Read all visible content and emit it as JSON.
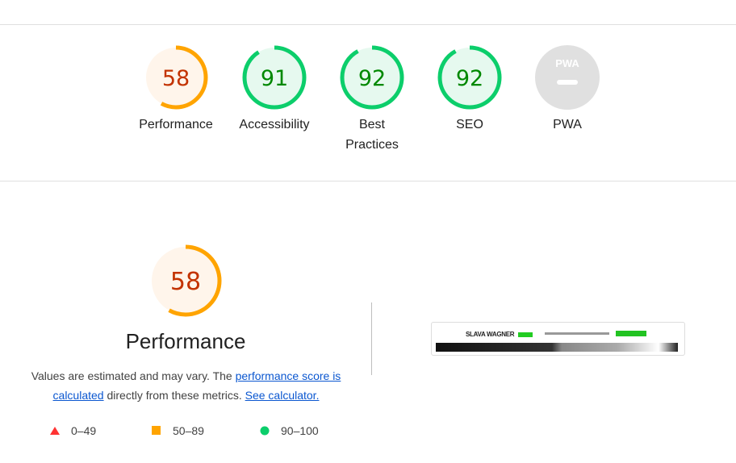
{
  "categories": [
    {
      "label": "Performance",
      "score": 58,
      "rating": "average"
    },
    {
      "label": "Accessibility",
      "score": 91,
      "rating": "pass"
    },
    {
      "label": "Best Practices",
      "score": 92,
      "rating": "pass"
    },
    {
      "label": "SEO",
      "score": 92,
      "rating": "pass"
    },
    {
      "label": "PWA",
      "score": null,
      "rating": "na",
      "badge": "PWA"
    }
  ],
  "colors": {
    "average": "#ffa400",
    "average_text": "#c33300",
    "average_bg": "#fff5eb",
    "pass": "#0cce6b",
    "pass_text": "#008800",
    "pass_bg": "#e6f9ef",
    "fail": "#ff3333",
    "na": "#e0e0e0"
  },
  "performance": {
    "score": "58",
    "title": "Performance",
    "desc_1": "Values are estimated and may vary. The ",
    "link_1": "performance score is calculated",
    "desc_2": " directly from these metrics. ",
    "link_2": "See calculator."
  },
  "legend": [
    {
      "range": "0–49",
      "icon": "triangle-icon"
    },
    {
      "range": "50–89",
      "icon": "square-icon"
    },
    {
      "range": "90–100",
      "icon": "circle-icon"
    }
  ],
  "screenshot": {
    "site_name": "SLAVA WAGNER"
  }
}
